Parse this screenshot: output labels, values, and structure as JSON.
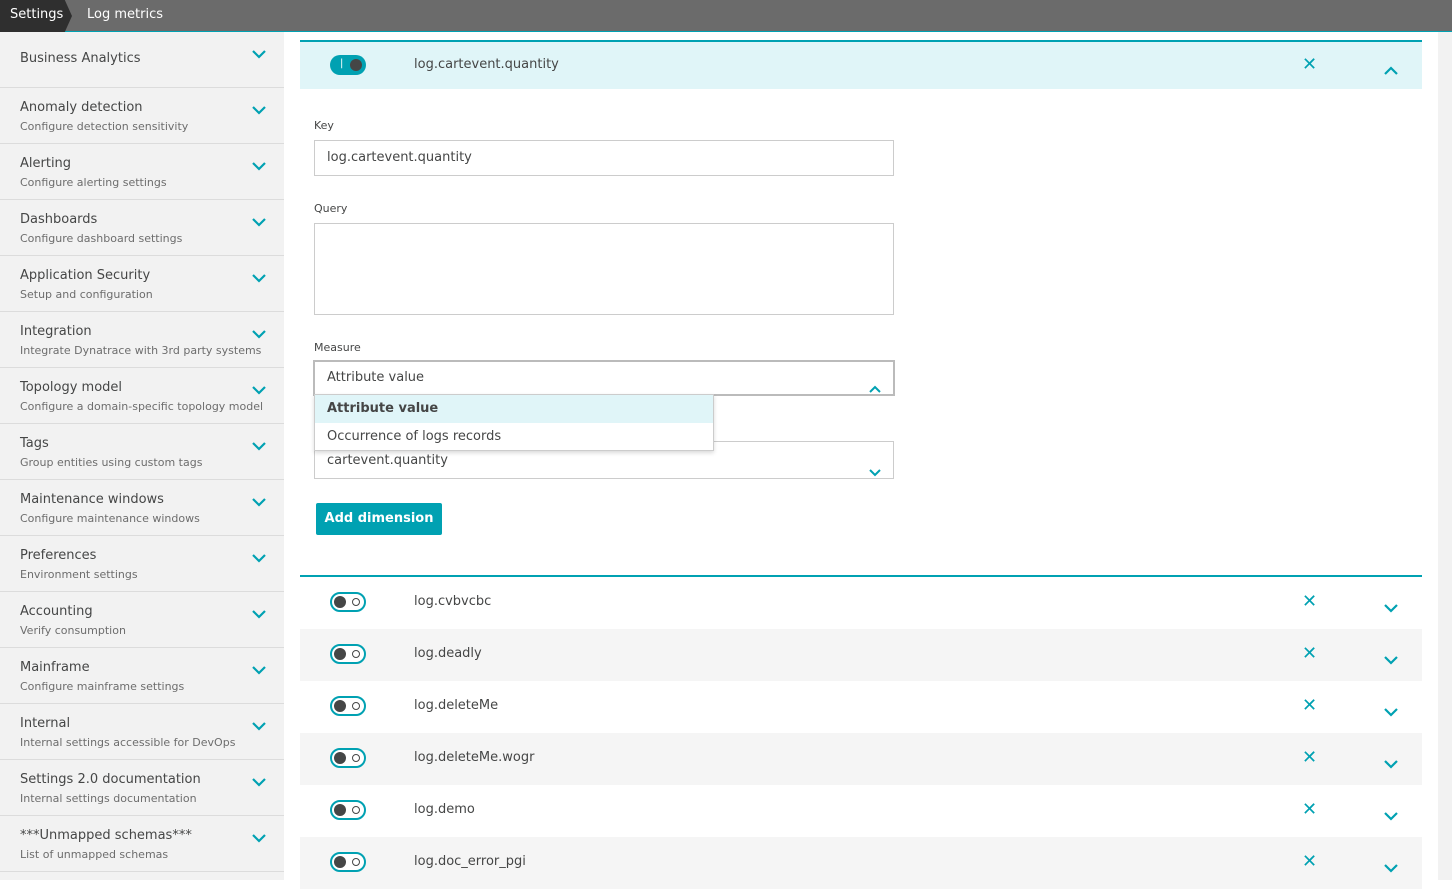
{
  "breadcrumb": [
    "Settings",
    "Log metrics"
  ],
  "sidebar": [
    {
      "title": "Business Analytics",
      "sub": ""
    },
    {
      "title": "Anomaly detection",
      "sub": "Configure detection sensitivity"
    },
    {
      "title": "Alerting",
      "sub": "Configure alerting settings"
    },
    {
      "title": "Dashboards",
      "sub": "Configure dashboard settings"
    },
    {
      "title": "Application Security",
      "sub": "Setup and configuration"
    },
    {
      "title": "Integration",
      "sub": "Integrate Dynatrace with 3rd party systems"
    },
    {
      "title": "Topology model",
      "sub": "Configure a domain-specific topology model"
    },
    {
      "title": "Tags",
      "sub": "Group entities using custom tags"
    },
    {
      "title": "Maintenance windows",
      "sub": "Configure maintenance windows"
    },
    {
      "title": "Preferences",
      "sub": "Environment settings"
    },
    {
      "title": "Accounting",
      "sub": "Verify consumption"
    },
    {
      "title": "Mainframe",
      "sub": "Configure mainframe settings"
    },
    {
      "title": "Internal",
      "sub": "Internal settings accessible for DevOps"
    },
    {
      "title": "Settings 2.0 documentation",
      "sub": "Internal settings documentation"
    },
    {
      "title": "***Unmapped schemas***",
      "sub": "List of unmapped schemas"
    }
  ],
  "expanded": {
    "name": "log.cartevent.quantity",
    "enabled": true,
    "key_label": "Key",
    "key_value": "log.cartevent.quantity",
    "query_label": "Query",
    "query_value": "",
    "measure_label": "Measure",
    "measure_value": "Attribute value",
    "measure_options": [
      "Attribute value",
      "Occurrence of logs records"
    ],
    "attribute_value": "cartevent.quantity",
    "add_dimension": "Add dimension"
  },
  "metrics": [
    {
      "name": "log.cvbvcbc",
      "enabled": false
    },
    {
      "name": "log.deadly",
      "enabled": false
    },
    {
      "name": "log.deleteMe",
      "enabled": false
    },
    {
      "name": "log.deleteMe.wogr",
      "enabled": false
    },
    {
      "name": "log.demo",
      "enabled": false
    },
    {
      "name": "log.doc_error_pgi",
      "enabled": false
    }
  ],
  "colors": {
    "accent": "#00a1b2"
  }
}
